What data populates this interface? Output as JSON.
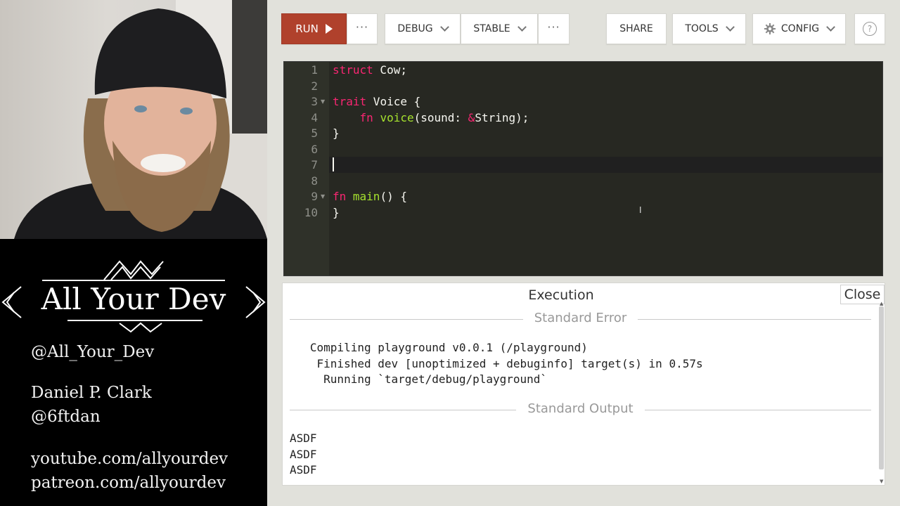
{
  "stream": {
    "brand": "All Your Dev",
    "handle": "@All_Your_Dev",
    "presenter_name": "Daniel P. Clark",
    "presenter_handle": "@6ftdan",
    "youtube": "youtube.com/allyourdev",
    "patreon": "patreon.com/allyourdev"
  },
  "toolbar": {
    "run": "RUN",
    "more": "···",
    "mode": "DEBUG",
    "channel": "STABLE",
    "more2": "···",
    "share": "SHARE",
    "tools": "TOOLS",
    "config": "CONFIG",
    "help": "?"
  },
  "editor": {
    "line_numbers": [
      "1",
      "2",
      "3",
      "4",
      "5",
      "6",
      "7",
      "8",
      "9",
      "10"
    ],
    "lines": [
      "struct Cow;",
      "",
      "trait Voice {",
      "    fn voice(sound: &String);",
      "}",
      "",
      "",
      "",
      "fn main() {",
      "}"
    ]
  },
  "output": {
    "title": "Execution",
    "close": "Close",
    "stderr_label": "Standard Error",
    "stderr_lines": [
      "   Compiling playground v0.0.1 (/playground)",
      "    Finished dev [unoptimized + debuginfo] target(s) in 0.57s",
      "     Running `target/debug/playground`"
    ],
    "stdout_label": "Standard Output",
    "stdout_lines": [
      "ASDF",
      "ASDF",
      "ASDF"
    ]
  },
  "colors": {
    "run_button": "#b0412c",
    "editor_bg": "#272822",
    "keyword": "#f92672",
    "function": "#a6e22e"
  }
}
